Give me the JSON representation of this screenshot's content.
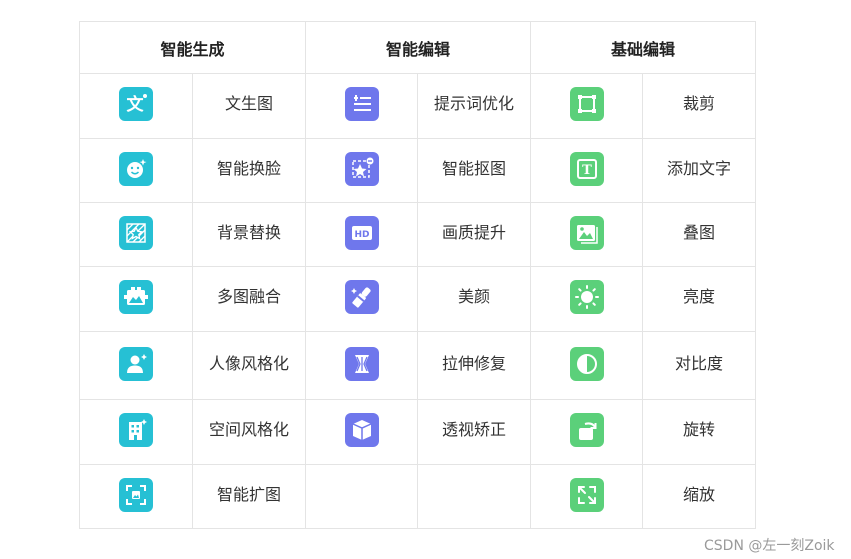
{
  "columns": [
    {
      "header": "智能生成",
      "color": "#26c0d4",
      "items": [
        {
          "label": "文生图",
          "icon": "text-to-image-icon"
        },
        {
          "label": "智能换脸",
          "icon": "face-swap-icon"
        },
        {
          "label": "背景替换",
          "icon": "background-replace-icon"
        },
        {
          "label": "多图融合",
          "icon": "multi-image-fusion-icon"
        },
        {
          "label": "人像风格化",
          "icon": "portrait-style-icon"
        },
        {
          "label": "空间风格化",
          "icon": "space-style-icon"
        },
        {
          "label": "智能扩图",
          "icon": "image-expand-icon"
        }
      ]
    },
    {
      "header": "智能编辑",
      "color": "#6f77ec",
      "items": [
        {
          "label": "提示词优化",
          "icon": "prompt-optimize-icon"
        },
        {
          "label": "智能抠图",
          "icon": "smart-cutout-icon"
        },
        {
          "label": "画质提升",
          "icon": "hd-icon"
        },
        {
          "label": "美颜",
          "icon": "beauty-icon"
        },
        {
          "label": "拉伸修复",
          "icon": "stretch-repair-icon"
        },
        {
          "label": "透视矫正",
          "icon": "perspective-correct-icon"
        }
      ]
    },
    {
      "header": "基础编辑",
      "color": "#5bd07a",
      "items": [
        {
          "label": "裁剪",
          "icon": "crop-icon"
        },
        {
          "label": "添加文字",
          "icon": "add-text-icon"
        },
        {
          "label": "叠图",
          "icon": "overlay-image-icon"
        },
        {
          "label": "亮度",
          "icon": "brightness-icon"
        },
        {
          "label": "对比度",
          "icon": "contrast-icon"
        },
        {
          "label": "旋转",
          "icon": "rotate-icon"
        },
        {
          "label": "缩放",
          "icon": "zoom-icon"
        }
      ]
    }
  ],
  "watermark": "CSDN @左一刻Zoik"
}
